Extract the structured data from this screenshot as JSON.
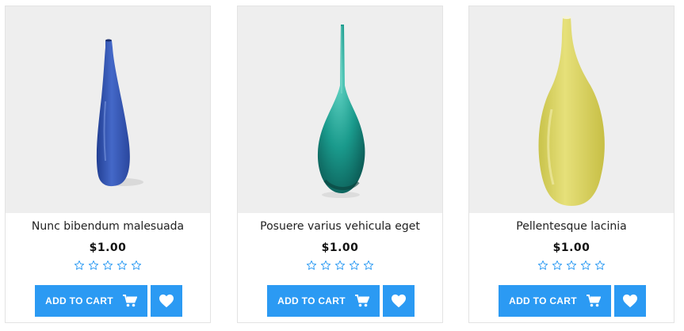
{
  "products": [
    {
      "name": "Nunc bibendum malesuada",
      "price": "$1.00",
      "rating": 0,
      "max_rating": 5,
      "vase_color": "#3a57b2",
      "add_to_cart_label": "ADD TO CART",
      "cart_icon": "cart-icon",
      "wishlist_icon": "heart-icon"
    },
    {
      "name": "Posuere varius vehicula eget",
      "price": "$1.00",
      "rating": 0,
      "max_rating": 5,
      "vase_color": "#1a9a8c",
      "add_to_cart_label": "ADD TO CART",
      "cart_icon": "cart-icon",
      "wishlist_icon": "heart-icon"
    },
    {
      "name": "Pellentesque lacinia",
      "price": "$1.00",
      "rating": 0,
      "max_rating": 5,
      "vase_color": "#dcd45e",
      "add_to_cart_label": "ADD TO CART",
      "cart_icon": "cart-icon",
      "wishlist_icon": "heart-icon"
    }
  ],
  "colors": {
    "accent": "#2b9af3",
    "image_bg": "#eeeeee",
    "star_outline": "#2b9af3"
  }
}
